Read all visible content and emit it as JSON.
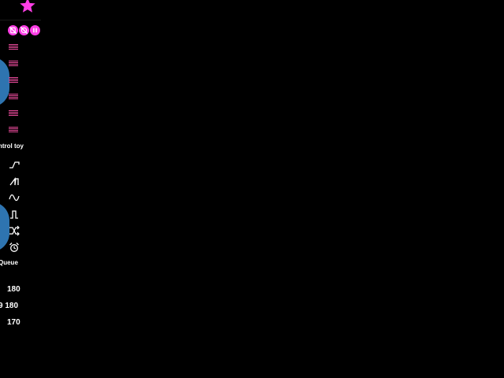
{
  "colors": {
    "background": "#000000",
    "accent": "#ff3ee6",
    "speed_bars": "#e84a9a",
    "panel_blue": "#2e74b0"
  },
  "icons": {
    "favorite": "star-icon",
    "toggles": [
      "no-vibrate-icon",
      "no-rotate-icon",
      "pause-icon"
    ],
    "patterns": [
      "step-up-icon",
      "pulse-up-icon",
      "wave-icon",
      "square-wave-icon",
      "shuffle-icon",
      "alarm-clock-icon"
    ]
  },
  "speed_levels": 6,
  "control": {
    "label": "ntrol toy"
  },
  "queue": {
    "label": "Queue",
    "items": [
      "180",
      "9 180",
      "170"
    ]
  }
}
